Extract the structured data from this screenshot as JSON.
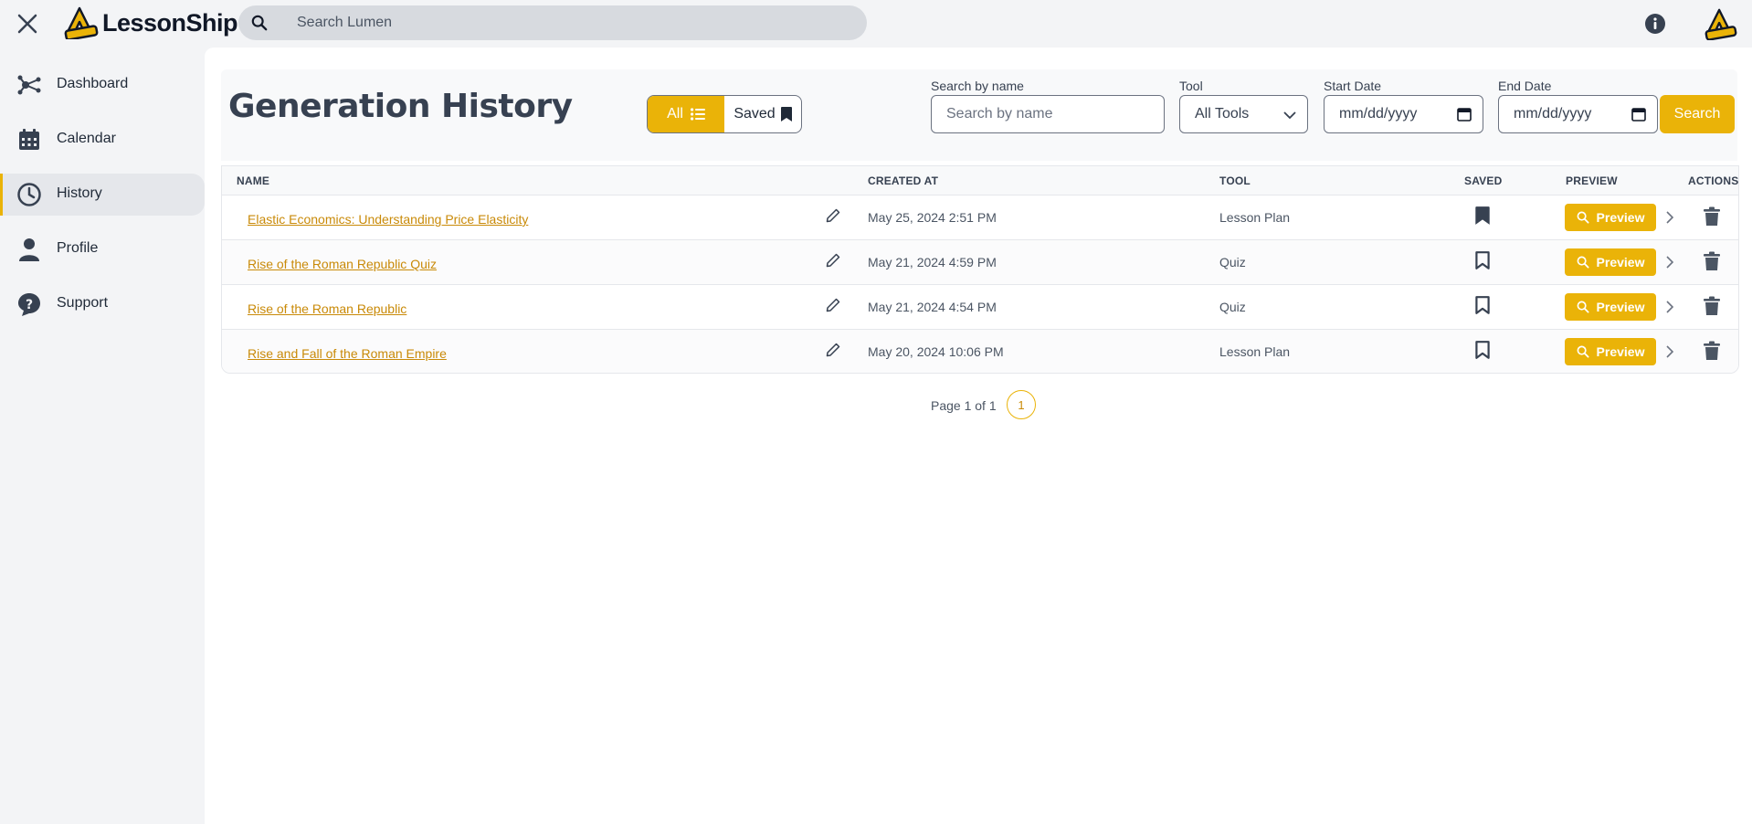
{
  "app": {
    "brand": "LessonShip"
  },
  "colors": {
    "accent": "#eab308",
    "link": "#c98a08",
    "text": "#374151"
  },
  "topbar": {
    "search_placeholder": "Search Lumen"
  },
  "sidebar": {
    "items": [
      {
        "label": "Dashboard",
        "icon": "dashboard-icon"
      },
      {
        "label": "Calendar",
        "icon": "calendar-icon"
      },
      {
        "label": "History",
        "icon": "history-icon",
        "active": true
      },
      {
        "label": "Profile",
        "icon": "profile-icon"
      },
      {
        "label": "Support",
        "icon": "support-icon"
      }
    ]
  },
  "page": {
    "title": "Generation History"
  },
  "filters": {
    "toggle_all": "All",
    "toggle_saved": "Saved",
    "name_label": "Search by name",
    "name_placeholder": "Search by name",
    "tool_label": "Tool",
    "tool_value": "All Tools",
    "start_label": "Start Date",
    "start_value": "mm/dd/yyyy",
    "end_label": "End Date",
    "end_value": "mm/dd/yyyy",
    "search_label": "Search"
  },
  "table": {
    "headers": {
      "name": "NAME",
      "created": "CREATED AT",
      "tool": "TOOL",
      "saved": "SAVED",
      "preview": "PREVIEW",
      "actions": "ACTIONS"
    },
    "preview_label": "Preview",
    "rows": [
      {
        "name": "Elastic Economics: Understanding Price Elasticity",
        "created": "May 25, 2024 2:51 PM",
        "tool": "Lesson Plan",
        "saved": true
      },
      {
        "name": "Rise of the Roman Republic Quiz",
        "created": "May 21, 2024 4:59 PM",
        "tool": "Quiz",
        "saved": false
      },
      {
        "name": "Rise of the Roman Republic",
        "created": "May 21, 2024 4:54 PM",
        "tool": "Quiz",
        "saved": false
      },
      {
        "name": "Rise and Fall of the Roman Empire",
        "created": "May 20, 2024 10:06 PM",
        "tool": "Lesson Plan",
        "saved": false
      }
    ]
  },
  "pagination": {
    "text": "Page 1 of 1",
    "current": "1"
  }
}
